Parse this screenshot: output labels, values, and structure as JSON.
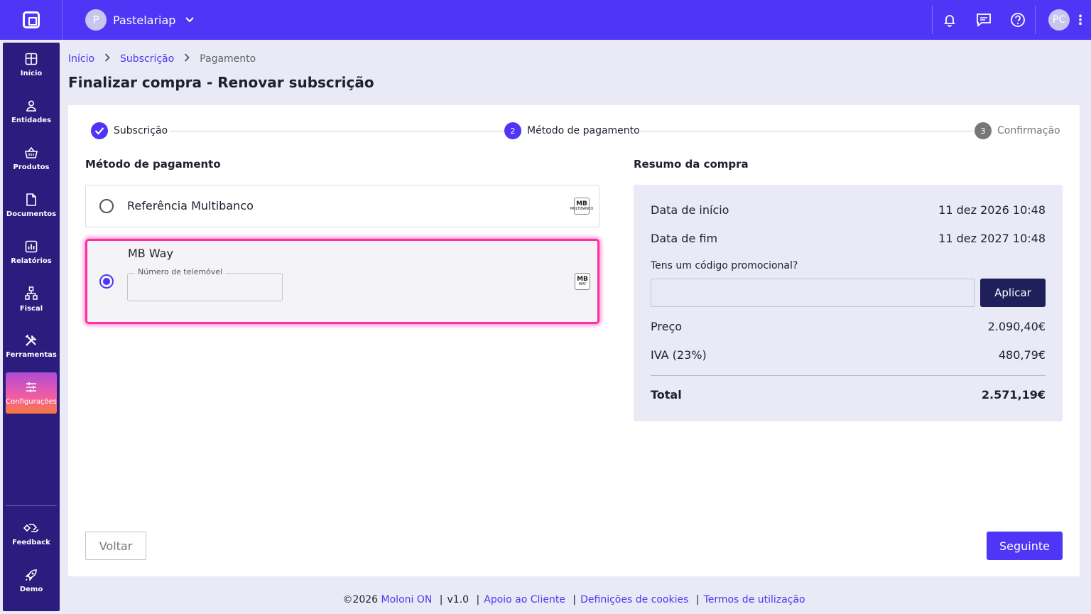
{
  "topbar": {
    "company_initial": "P",
    "company_name": "Pastelariap",
    "user_initials": "PC"
  },
  "sidebar": {
    "items": [
      {
        "label": "Início",
        "icon": "grid-icon"
      },
      {
        "label": "Entidades",
        "icon": "person-icon"
      },
      {
        "label": "Produtos",
        "icon": "basket-icon"
      },
      {
        "label": "Documentos",
        "icon": "document-icon"
      },
      {
        "label": "Relatórios",
        "icon": "chart-icon"
      },
      {
        "label": "Fiscal",
        "icon": "hierarchy-icon"
      },
      {
        "label": "Ferramentas",
        "icon": "tools-icon"
      },
      {
        "label": "Configurações",
        "icon": "sliders-icon",
        "active": true
      }
    ],
    "bottom_items": [
      {
        "label": "Feedback",
        "icon": "feedback-icon"
      },
      {
        "label": "Demo",
        "icon": "rocket-icon"
      }
    ]
  },
  "breadcrumb": {
    "home": "Início",
    "subscription": "Subscrição",
    "current": "Pagamento"
  },
  "page_title": "Finalizar compra - Renovar subscrição",
  "stepper": {
    "steps": [
      {
        "number": "1",
        "label": "Subscrição",
        "state": "done"
      },
      {
        "number": "2",
        "label": "Método de pagamento",
        "state": "current"
      },
      {
        "number": "3",
        "label": "Confirmação",
        "state": "upcoming"
      }
    ]
  },
  "payment": {
    "title": "Método de pagamento",
    "options": [
      {
        "label": "Referência Multibanco",
        "logo_text": "MB",
        "logo_subtext": "MULTIBANCO",
        "selected": false
      },
      {
        "label": "MB Way",
        "logo_text": "MB",
        "logo_subtext": "WAY",
        "selected": true
      }
    ],
    "phone_field_label": "Número de telemóvel",
    "phone_value": ""
  },
  "summary": {
    "title": "Resumo da compra",
    "start_label": "Data de início",
    "start_value": "11 dez 2026 10:48",
    "end_label": "Data de fim",
    "end_value": "11 dez 2027 10:48",
    "promo_label": "Tens um código promocional?",
    "promo_value": "",
    "apply_label": "Aplicar",
    "price_label": "Preço",
    "price_value": "2.090,40€",
    "vat_label": "IVA (23%)",
    "vat_value": "480,79€",
    "total_label": "Total",
    "total_value": "2.571,19€"
  },
  "actions": {
    "back_label": "Voltar",
    "next_label": "Seguinte"
  },
  "footer": {
    "copyright": "©2026",
    "brand": "Moloni ON",
    "version": "v1.0",
    "support": "Apoio ao Cliente",
    "cookies": "Definições de cookies",
    "terms": "Termos de utilização"
  },
  "colors": {
    "primary": "#4f35f5",
    "sidebar": "#2b1c7e",
    "highlight": "#ff2ea5",
    "apply_button": "#1f1f5c"
  }
}
